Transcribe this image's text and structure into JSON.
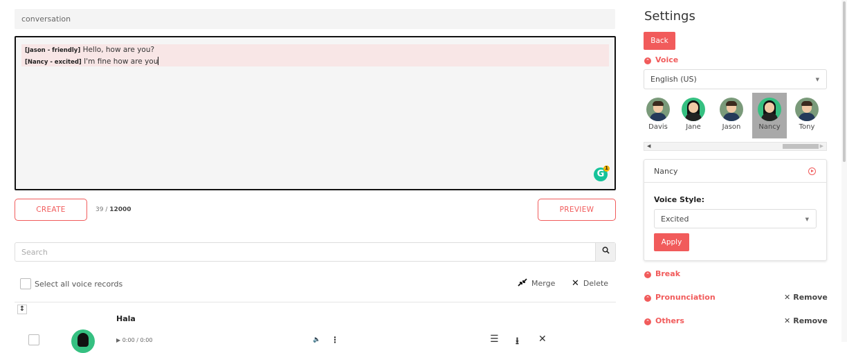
{
  "editor": {
    "title_placeholder": "conversation",
    "lines": [
      {
        "tag": "[Jason - friendly]",
        "text": "Hello, how are you?"
      },
      {
        "tag": "[Nancy - excited]",
        "text": "I'm fine how are you"
      }
    ],
    "grammarly_icon": "G",
    "grammarly_count": "1"
  },
  "actions": {
    "create_label": "CREATE",
    "preview_label": "PREVIEW",
    "char_count": "39",
    "char_separator": " / ",
    "char_limit": "12000"
  },
  "search": {
    "placeholder": "Search",
    "icon": "search-icon"
  },
  "records_toolbar": {
    "select_all_label": "Select all voice records",
    "merge_label": "Merge",
    "delete_label": "Delete"
  },
  "record": {
    "title": "Hala",
    "time": "0:00 / 0:00"
  },
  "settings": {
    "title": "Settings",
    "back_label": "Back",
    "voice_section": "Voice",
    "language": "English (US)",
    "avatars": [
      {
        "name": "Davis",
        "gender": "m"
      },
      {
        "name": "Jane",
        "gender": "f"
      },
      {
        "name": "Jason",
        "gender": "m"
      },
      {
        "name": "Nancy",
        "gender": "f"
      },
      {
        "name": "Tony",
        "gender": "m"
      }
    ],
    "selected_voice": "Nancy",
    "voice_style_label": "Voice Style:",
    "voice_style_value": "Excited",
    "apply_label": "Apply",
    "break_section": "Break",
    "pronunciation_section": "Pronunciation",
    "others_section": "Others",
    "remove_label": "Remove",
    "accent_color": "#f15b5b"
  }
}
